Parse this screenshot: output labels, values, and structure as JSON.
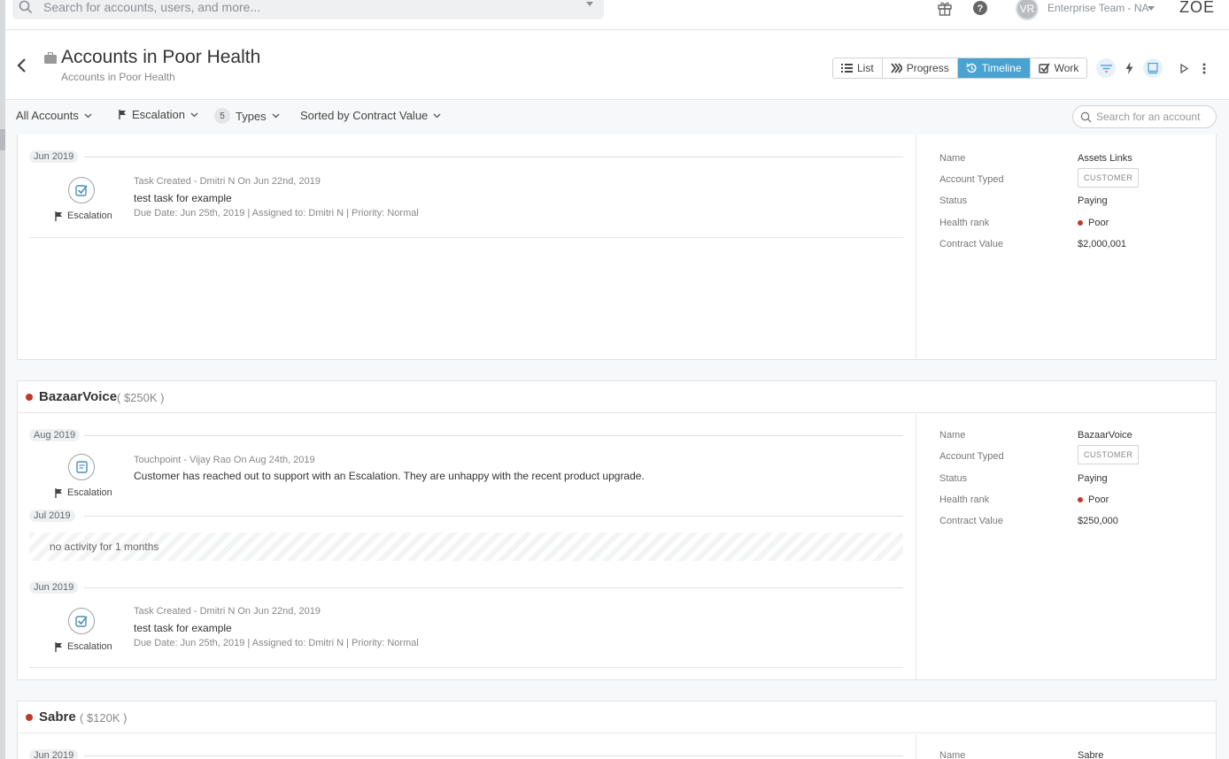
{
  "topbar": {
    "search_placeholder": "Search for accounts, users, and more...",
    "avatar_initials": "VR",
    "team": "Enterprise Team - NA",
    "brand": "ZOE"
  },
  "header": {
    "title": "Accounts in Poor Health",
    "subtitle": "Accounts in Poor Health",
    "views": [
      "List",
      "Progress",
      "Timeline",
      "Work"
    ],
    "active_view": "Timeline"
  },
  "filters": {
    "accounts": "All Accounts",
    "escalation": "Escalation",
    "types_count": "5",
    "types": "Types",
    "sort": "Sorted by Contract Value",
    "account_search_placeholder": "Search for an account"
  },
  "labels": {
    "name": "Name",
    "account_type": "Account Typed",
    "status": "Status",
    "health_rank": "Health rank",
    "contract_value": "Contract Value"
  },
  "accounts": [
    {
      "name": "Assets Links",
      "type": "CUSTOMER",
      "status": "Paying",
      "health": "Poor",
      "contract": "$2,000,001",
      "timeline": {
        "month1": "Jun 2019",
        "e1": {
          "meta": "Task Created - Dmitri N On Jun 22nd, 2019",
          "body": "test task for example",
          "details": "Due Date: Jun 25th, 2019 | Assigned to: Dmitri N | Priority: Normal",
          "tag": "Escalation"
        }
      }
    },
    {
      "name": "BazaarVoice",
      "value": "( $250K )",
      "type": "CUSTOMER",
      "status": "Paying",
      "health": "Poor",
      "contract": "$250,000",
      "timeline": {
        "month1": "Aug 2019",
        "e1": {
          "meta": "Touchpoint - Vijay Rao On Aug 24th, 2019",
          "body": "Customer has reached out to support with an Escalation. They are unhappy with the recent product upgrade.",
          "tag": "Escalation"
        },
        "month2": "Jul 2019",
        "no_activity": "no activity for 1 months",
        "month3": "Jun 2019",
        "e2": {
          "meta": "Task Created - Dmitri N On Jun 22nd, 2019",
          "body": "test task for example",
          "details": "Due Date: Jun 25th, 2019 | Assigned to: Dmitri N | Priority: Normal",
          "tag": "Escalation"
        }
      }
    },
    {
      "name": "Sabre",
      "value": "( $120K )",
      "month1": "Jun 2019",
      "side_name": "Sabre"
    }
  ]
}
